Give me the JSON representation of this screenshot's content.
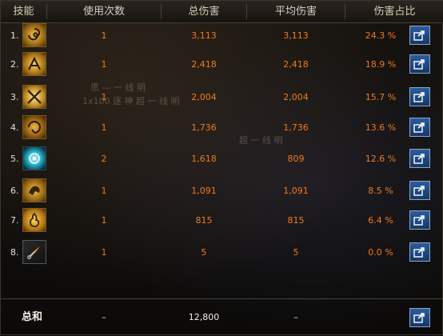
{
  "header": {
    "skill": "技能",
    "uses": "使用次数",
    "total_damage": "总伤害",
    "avg_damage": "平均伤害",
    "damage_share": "伤害占比"
  },
  "rows": [
    {
      "num": "1.",
      "icon": "golden-spiral-rune-icon",
      "uses": "1",
      "total": "3,113",
      "avg": "3,113",
      "share": "24.3 %"
    },
    {
      "num": "2.",
      "icon": "golden-lion-claw-icon",
      "uses": "1",
      "total": "2,418",
      "avg": "2,418",
      "share": "18.9 %"
    },
    {
      "num": "3.",
      "icon": "golden-cross-slash-icon",
      "uses": "1",
      "total": "2,004",
      "avg": "2,004",
      "share": "15.7 %"
    },
    {
      "num": "4.",
      "icon": "golden-vortex-strike-icon",
      "uses": "1",
      "total": "1,736",
      "avg": "1,736",
      "share": "13.6 %"
    },
    {
      "num": "5.",
      "icon": "cyan-orb-icon",
      "uses": "2",
      "total": "1,618",
      "avg": "809",
      "share": "12.6 %"
    },
    {
      "num": "6.",
      "icon": "golden-beast-roar-icon",
      "uses": "1",
      "total": "1,091",
      "avg": "1,091",
      "share": "8.5 %"
    },
    {
      "num": "7.",
      "icon": "golden-flame-burst-icon",
      "uses": "1",
      "total": "815",
      "avg": "815",
      "share": "6.4 %"
    },
    {
      "num": "8.",
      "icon": "kunai-dagger-icon",
      "uses": "1",
      "total": "5",
      "avg": "5",
      "share": "0.0 %"
    }
  ],
  "footer": {
    "label": "总和",
    "uses": "–",
    "total": "12,800",
    "avg": "–"
  },
  "share_button_icon": "share-export-icon",
  "colors": {
    "value_orange": "#f07a1c",
    "header_text": "#d8cfb8",
    "share_button_blue": "#2b5d9b",
    "icon_gold": "#e0a52a"
  }
}
